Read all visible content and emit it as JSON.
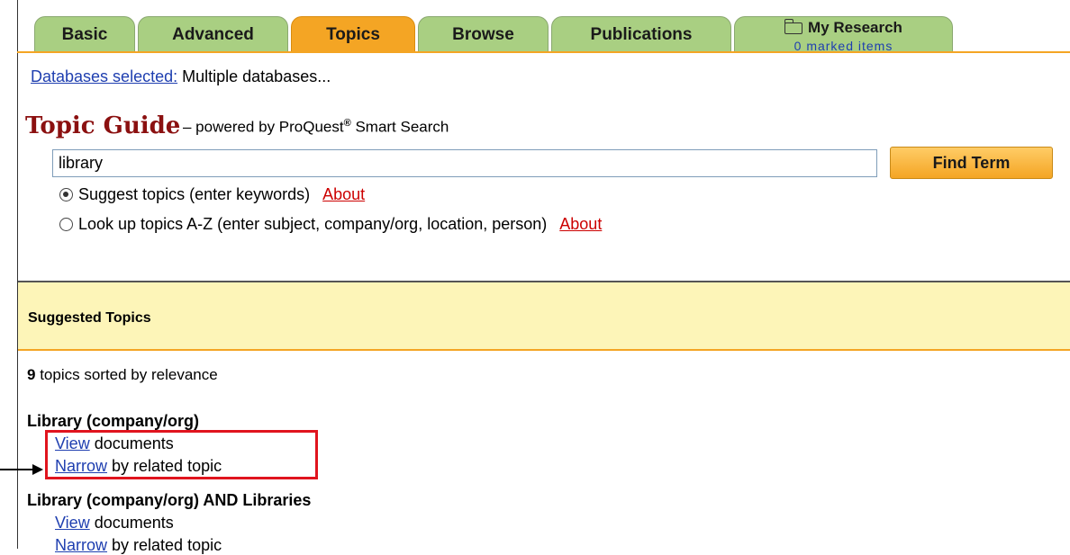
{
  "tabs": [
    {
      "label": "Basic"
    },
    {
      "label": "Advanced"
    },
    {
      "label": "Topics",
      "active": true
    },
    {
      "label": "Browse"
    },
    {
      "label": "Publications"
    },
    {
      "label": "My Research",
      "sub": "0 marked items",
      "icon": "folder-icon"
    }
  ],
  "databases": {
    "link": "Databases selected:",
    "value": "Multiple databases..."
  },
  "guide": {
    "title": "Topic Guide",
    "dash": "– powered by ProQuest",
    "reg": "®",
    "tail": " Smart Search"
  },
  "search": {
    "value": "library",
    "button": "Find Term"
  },
  "options": [
    {
      "label": "Suggest topics (enter keywords)",
      "about": "About",
      "checked": true
    },
    {
      "label": "Look up topics A-Z (enter subject, company/org, location, person)",
      "about": "About",
      "checked": false
    }
  ],
  "suggested": {
    "heading": "Suggested Topics",
    "count": "9",
    "count_text": " topics sorted by relevance"
  },
  "topics": [
    {
      "title": "Library (company/org)",
      "view_link": "View",
      "view_text": " documents",
      "narrow_link": "Narrow",
      "narrow_text": " by related topic"
    },
    {
      "title": "Library (company/org) AND Libraries",
      "view_link": "View",
      "view_text": " documents",
      "narrow_link": "Narrow",
      "narrow_text": " by related topic"
    }
  ],
  "colors": {
    "tab": "#a9cf82",
    "tab_active": "#f4a524",
    "title": "#8b1010",
    "link": "#1f3fb0",
    "about": "#cc0000",
    "banner": "#fdf5b8",
    "highlight": "#e0141e"
  }
}
